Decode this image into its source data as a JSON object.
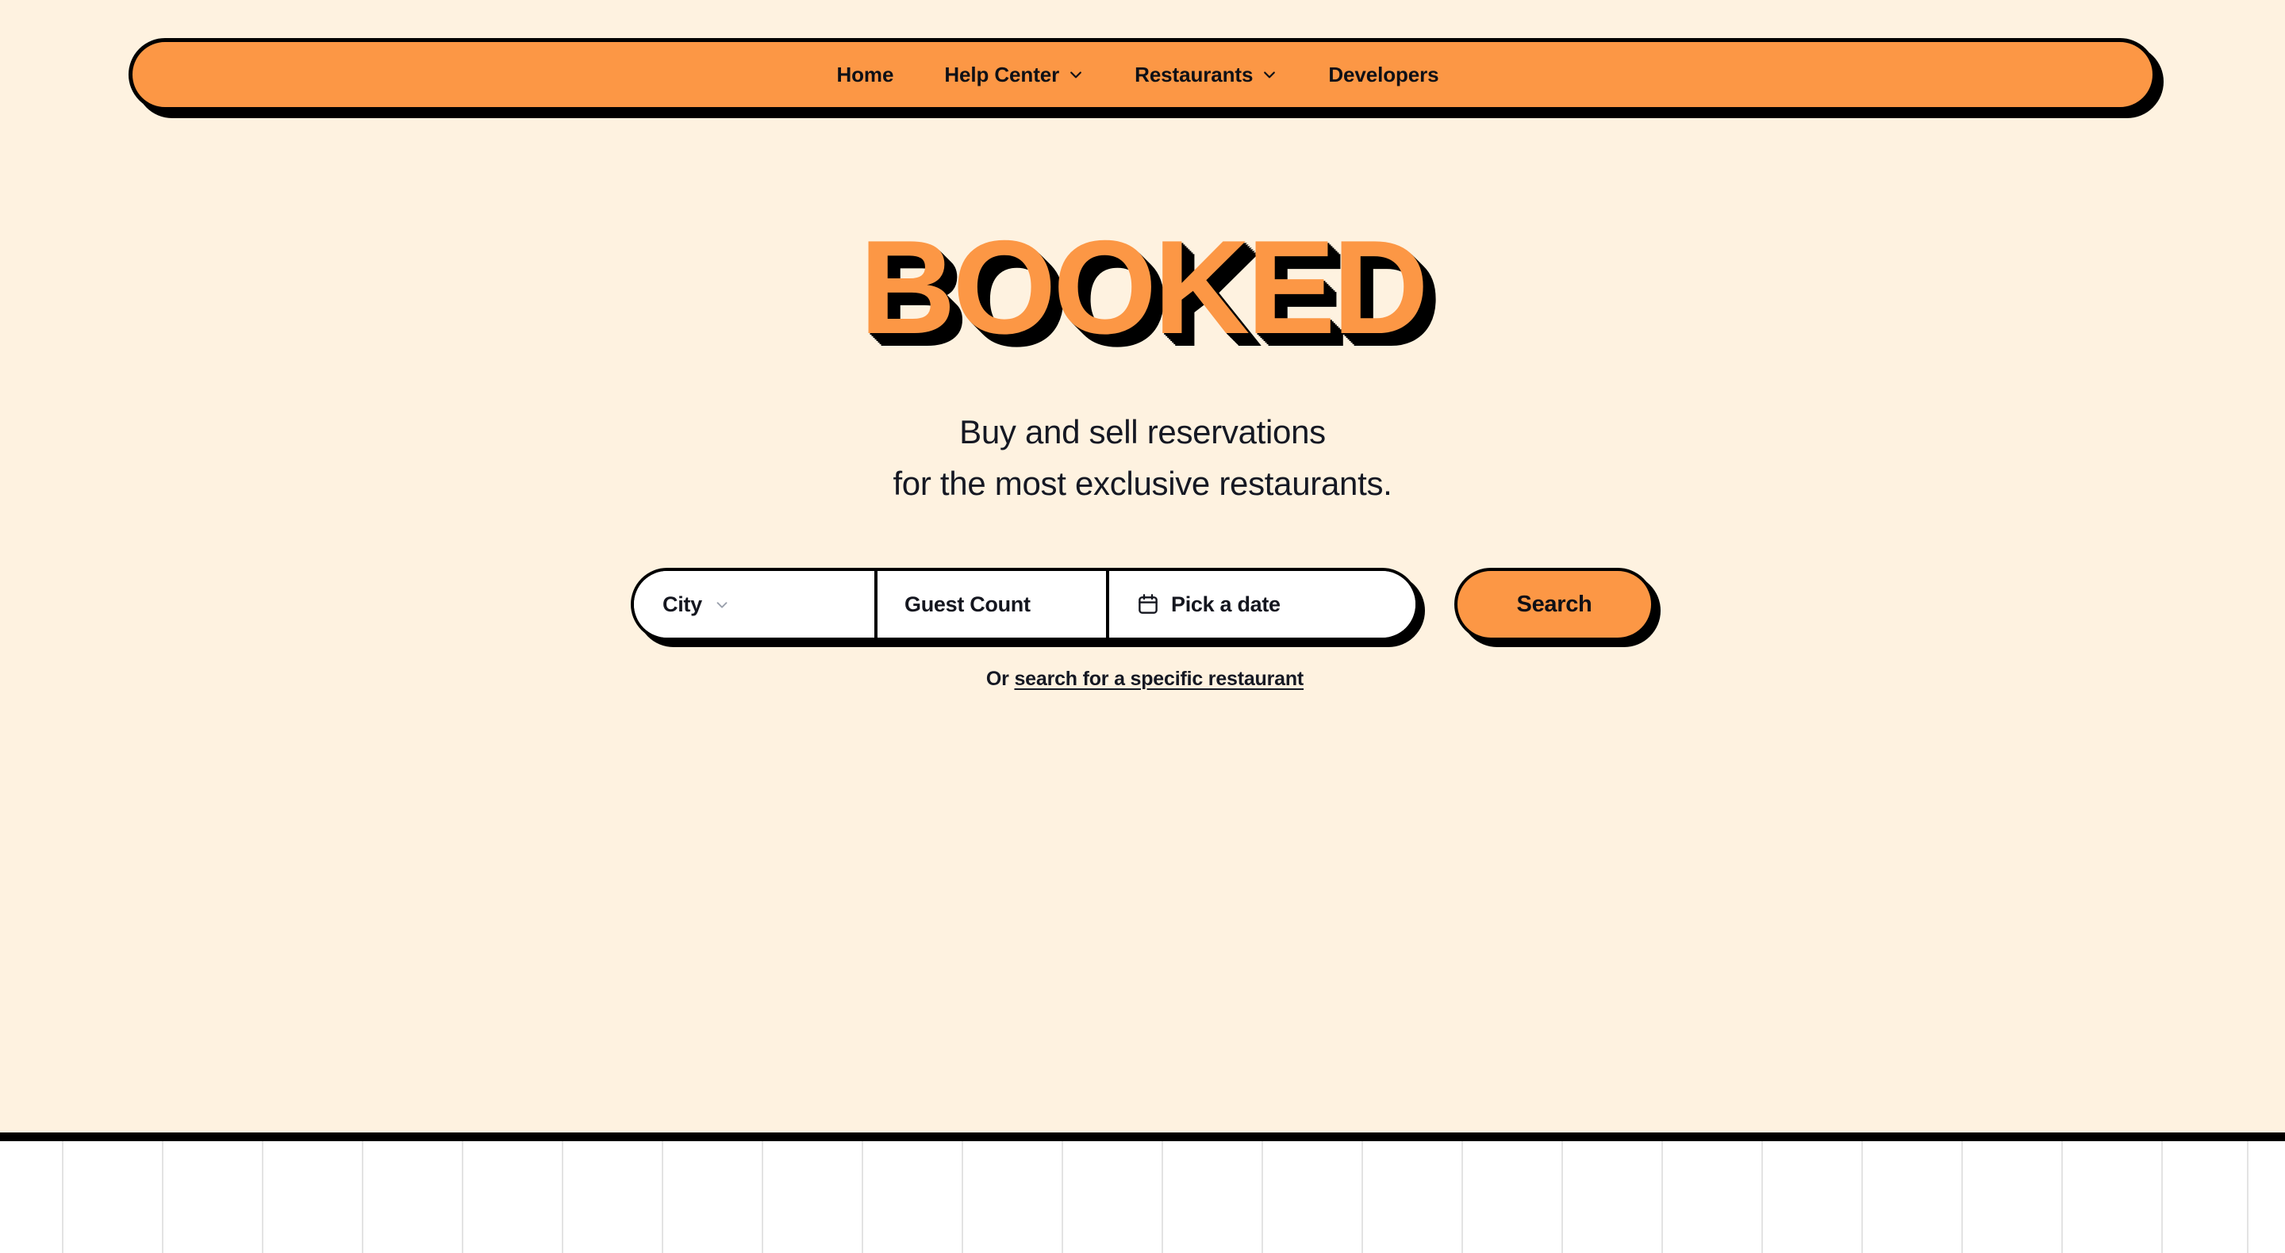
{
  "colors": {
    "background": "#FEF2E0",
    "accent_orange": "#FC9745",
    "ink": "#0E1016",
    "text_navy": "#151823",
    "grid_line": "#E3E3E3",
    "panel_white": "#FFFFFF"
  },
  "navbar": {
    "items": [
      {
        "label": "Home",
        "has_chevron": false,
        "icon": ""
      },
      {
        "label": "Help Center",
        "has_chevron": true,
        "icon": "chevron-down-icon"
      },
      {
        "label": "Restaurants",
        "has_chevron": true,
        "icon": "chevron-down-icon"
      },
      {
        "label": "Developers",
        "has_chevron": false,
        "icon": ""
      }
    ]
  },
  "hero": {
    "logo": "BOOKED",
    "tagline_line1": "Buy and sell reservations",
    "tagline_line2": "for the most exclusive restaurants."
  },
  "search": {
    "city": {
      "label": "City",
      "icon": "chevron-down-icon"
    },
    "guests": {
      "placeholder": "Guest Count",
      "value": ""
    },
    "date": {
      "label": "Pick a date",
      "icon": "calendar-icon"
    },
    "button_label": "Search"
  },
  "sub_link": {
    "prefix": "Or",
    "link_text": "search for a specific restaurant"
  }
}
